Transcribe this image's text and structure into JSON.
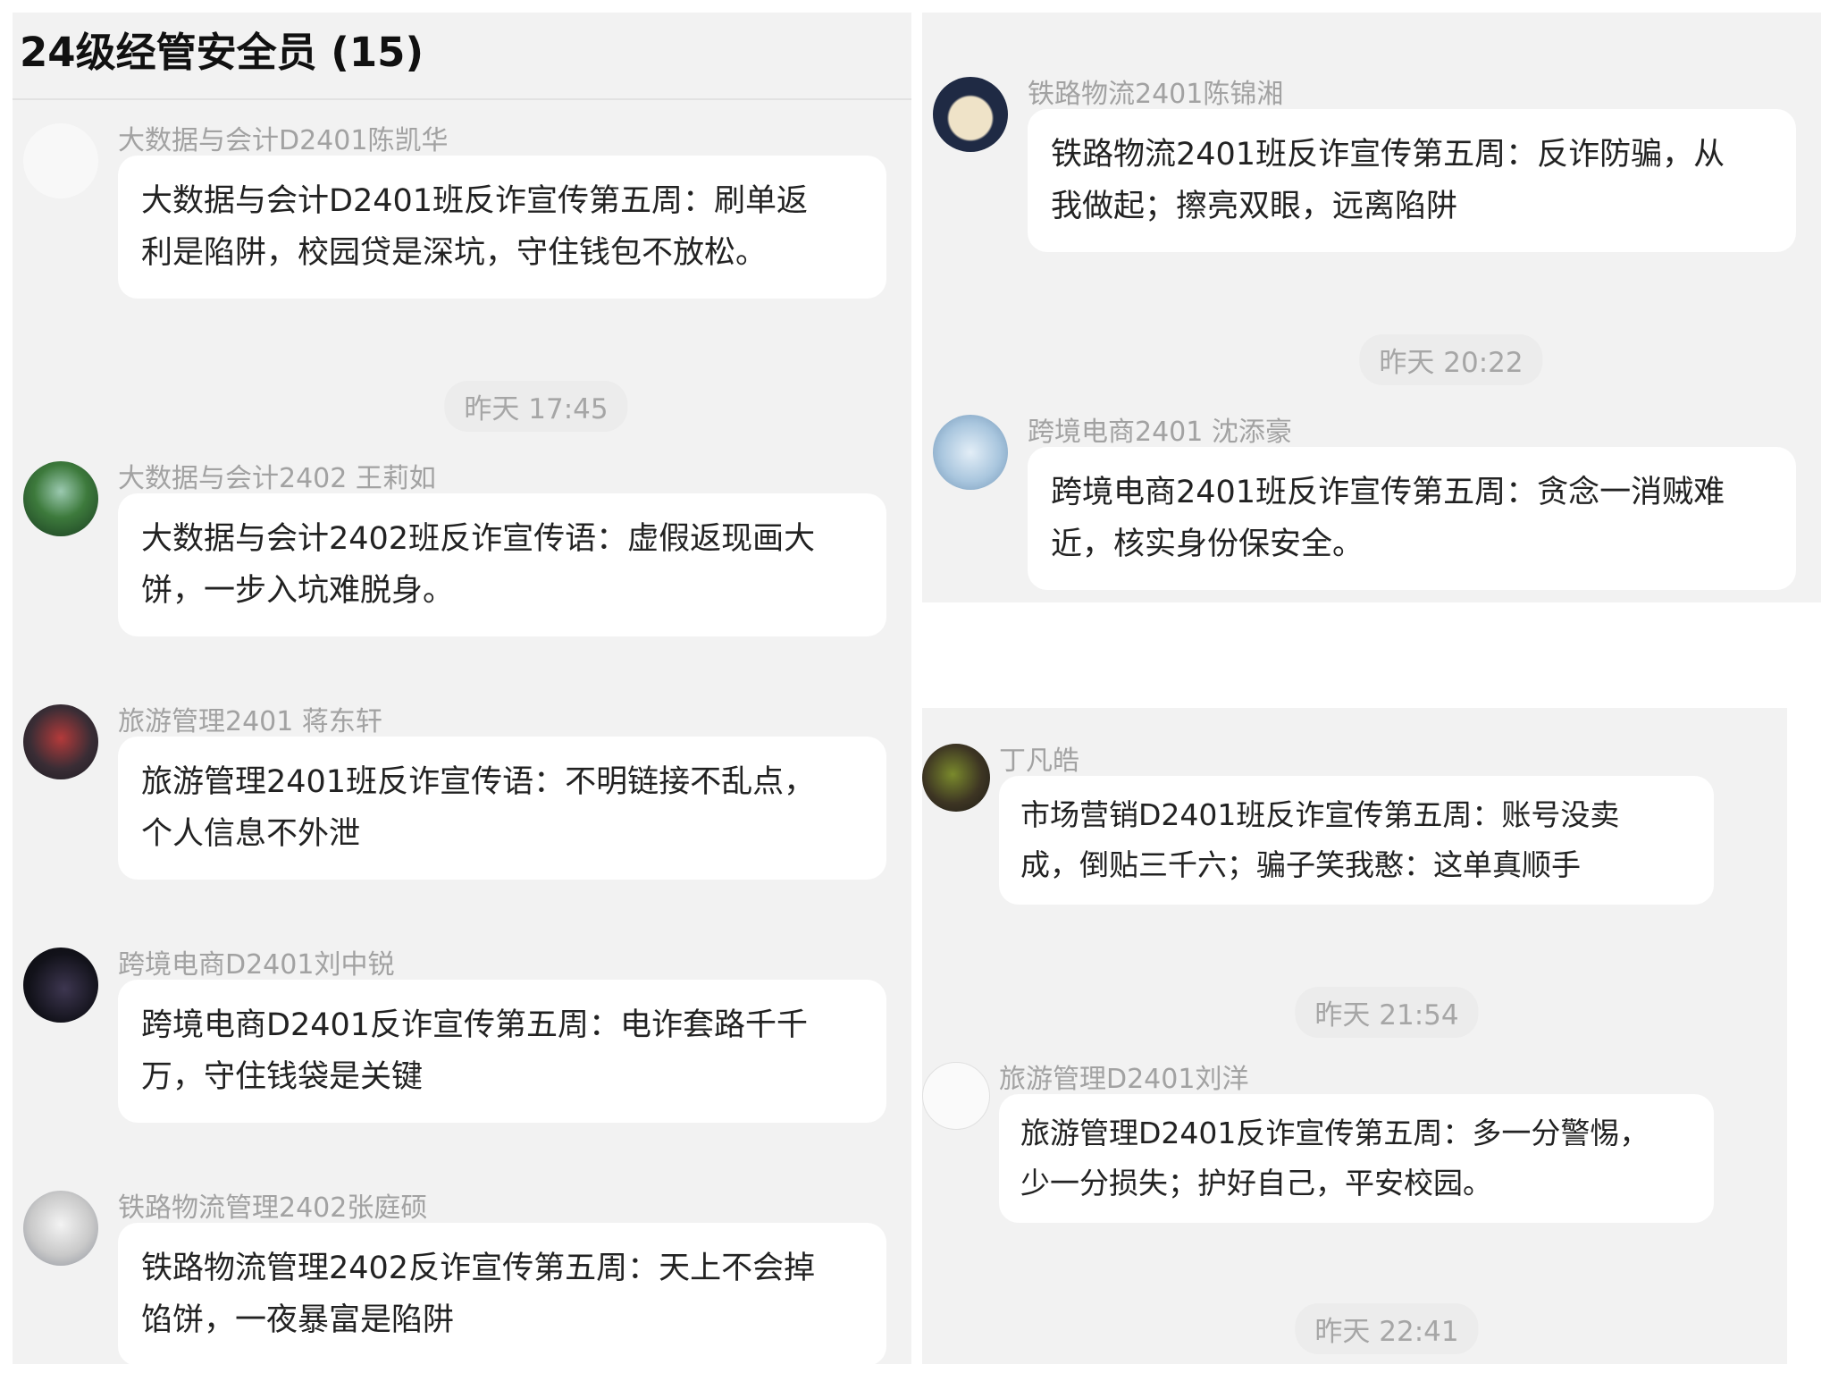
{
  "left": {
    "title": "24级经管安全员 (15)",
    "messages": [
      {
        "sender": "大数据与会计D2401陈凯华",
        "lines": [
          "大数据与会计D2401班反诈宣传第五周：刷单返",
          "利是陷阱，校园贷是深坑，守住钱包不放松。"
        ]
      },
      {
        "sender": "大数据与会计2402 王莉如",
        "lines": [
          "大数据与会计2402班反诈宣传语：虚假返现画大",
          "饼，一步入坑难脱身。"
        ]
      },
      {
        "sender": "旅游管理2401 蒋东轩",
        "lines": [
          "旅游管理2401班反诈宣传语：不明链接不乱点，",
          "个人信息不外泄"
        ]
      },
      {
        "sender": "跨境电商D2401刘中锐",
        "lines": [
          "跨境电商D2401反诈宣传第五周：电诈套路千千",
          "万，守住钱袋是关键"
        ]
      },
      {
        "sender": "铁路物流管理2402张庭硕",
        "lines": [
          "铁路物流管理2402反诈宣传第五周：天上不会掉",
          "馅饼，一夜暴富是陷阱"
        ]
      }
    ],
    "time1": "昨天 17:45"
  },
  "right_top": {
    "messages": [
      {
        "sender": "铁路物流2401陈锦湘",
        "lines": [
          "铁路物流2401班反诈宣传第五周：反诈防骗，从",
          "我做起；擦亮双眼，远离陷阱"
        ]
      },
      {
        "sender": "跨境电商2401 沈添豪",
        "lines": [
          "跨境电商2401班反诈宣传第五周：贪念一消贼难",
          "近，核实身份保安全。"
        ]
      }
    ],
    "time1": "昨天 20:22"
  },
  "right_bottom": {
    "messages": [
      {
        "sender": "丁凡皓",
        "lines": [
          "市场营销D2401班反诈宣传第五周：账号没卖",
          "成，倒贴三千六；骗子笑我憨：这单真顺手"
        ]
      },
      {
        "sender": "旅游管理D2401刘洋",
        "lines": [
          "旅游管理D2401反诈宣传第五周：多一分警惕，",
          "少一分损失；护好自己，平安校园。"
        ]
      }
    ],
    "time1": "昨天 21:54",
    "time2": "昨天 22:41"
  }
}
